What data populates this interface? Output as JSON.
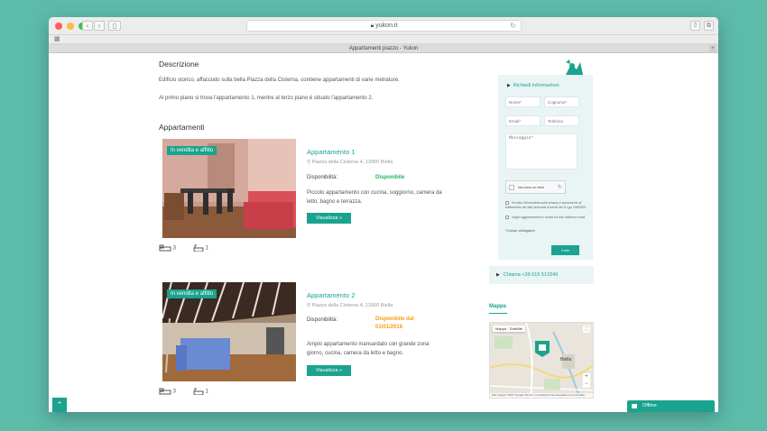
{
  "browser": {
    "url": "yukon.it",
    "tab_title": "Appartamenti piazzo - Yukon"
  },
  "colors": {
    "accent": "#1aa38e",
    "available": "#1db954",
    "from_date": "#f39c12",
    "background": "#5dbbaa"
  },
  "descrizione": {
    "heading": "Descrizione",
    "p1": "Edificio storico, affacciato sulla bella Piazza della Cisterna, contiene appartamenti di varie metrature.",
    "p2": "Al primo piano si trova l'appartamento 1, mentre al terzo piano è situato l'appartamento 2."
  },
  "appartamenti": {
    "heading": "Appartamenti",
    "items": [
      {
        "badge": "In vendita e affitto",
        "title": "Appartamento 1",
        "address": "Piazza della Cisterna 4, 13900 Biella",
        "disp_label": "Disponibilità:",
        "disp_value": "Disponibile",
        "description": "Piccolo appartamento con cucina, soggiorno, camera da letto, bagno e terrazza.",
        "button": "Visualizza »",
        "beds": "3",
        "baths": "1"
      },
      {
        "badge": "In vendita e affitto",
        "title": "Appartamento 2",
        "address": "Piazza della Cisterna 4, 13900 Biella",
        "disp_label": "Disponibilità:",
        "disp_value": "Disponibile dal 01/01/2018",
        "description": "Ampio appartamento mansardato con grande zona giorno, cucina, camera da letto e bagno.",
        "button": "Visualizza »",
        "beds": "3",
        "baths": "1"
      }
    ]
  },
  "form": {
    "title": "Richiedi informazioni",
    "nome_ph": "Nome*",
    "cognome_ph": "Cognome*",
    "email_ph": "Email*",
    "telefono_ph": "Telefono",
    "messaggio_ph": "Messaggio*",
    "captcha_text": "Non sono un robot",
    "privacy_text": "Ho letto l'informativa sulla privacy e acconsento al trattamento dei dati personali ai sensi del D.Lgs 196/2003",
    "newsletter_text": "Voglio aggiornamenti e novità sul mio indirizzo email",
    "required_note": "*Campi obbligatori",
    "submit": "Invia"
  },
  "call": "Chiama +39 015 513349",
  "map": {
    "heading": "Mappa",
    "tab_map": "Mappa",
    "tab_sat": "Satellite",
    "city": "Biella",
    "footer": "Dati mappa ©2017 Google  Termini e condizioni d'uso  Segnala un errore nella mappa"
  },
  "chat": "Offline",
  "back_to_top": "⌃"
}
